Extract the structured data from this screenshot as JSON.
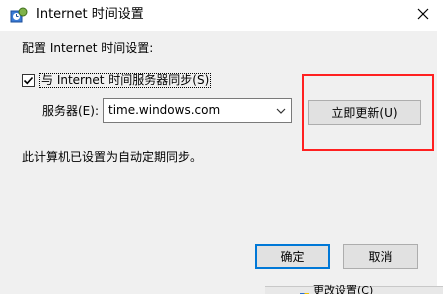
{
  "window": {
    "title": "Internet 时间设置",
    "icon": "clock-settings-icon",
    "close_icon": "close-icon"
  },
  "section_label": "配置 Internet 时间设置:",
  "sync": {
    "checked": true,
    "label": "与 Internet 时间服务器同步(S)"
  },
  "server": {
    "label": "服务器(E):",
    "value": "time.windows.com",
    "dropdown_icon": "chevron-down-icon"
  },
  "update_button": "立即更新(U)",
  "status_text": "此计算机已设置为自动定期同步。",
  "buttons": {
    "ok": "确定",
    "cancel": "取消"
  },
  "background_window": {
    "link_text": "更改设置(C)",
    "icon": "shield-icon"
  },
  "colors": {
    "highlight_border": "#ff2020",
    "default_button_border": "#0078d7",
    "window_background": "#f0f0f0"
  }
}
